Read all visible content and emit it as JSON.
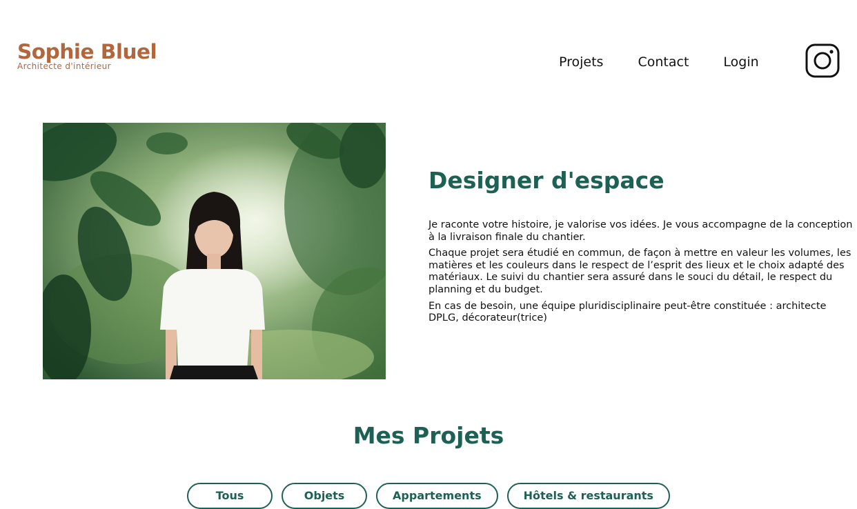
{
  "header": {
    "logo_title": "Sophie Bluel",
    "logo_subtitle": "Architecte d'intérieur",
    "nav": [
      {
        "label": "Projets"
      },
      {
        "label": "Contact"
      },
      {
        "label": "Login"
      }
    ],
    "social_icon": "instagram-icon"
  },
  "intro": {
    "photo_alt": "",
    "title": "Designer d'espace",
    "paragraphs": [
      "Je raconte votre histoire, je valorise vos idées. Je vous accompagne de la conception à la livraison finale du chantier.",
      "Chaque projet sera étudié en commun, de façon à mettre en valeur les volumes, les matières et les couleurs dans le respect de l’esprit des lieux et le choix adapté des matériaux. Le suivi du chantier sera assuré dans le souci du détail, le respect du planning et du budget.",
      "En cas de besoin, une équipe pluridisciplinaire peut-être constituée : architecte DPLG, décorateur(trice)"
    ]
  },
  "portfolio": {
    "title": "Mes Projets",
    "filters": [
      {
        "label": "Tous"
      },
      {
        "label": "Objets"
      },
      {
        "label": "Appartements"
      },
      {
        "label": "Hôtels & restaurants"
      }
    ]
  },
  "colors": {
    "brand": "#B1663C",
    "accent": "#1D6154"
  }
}
